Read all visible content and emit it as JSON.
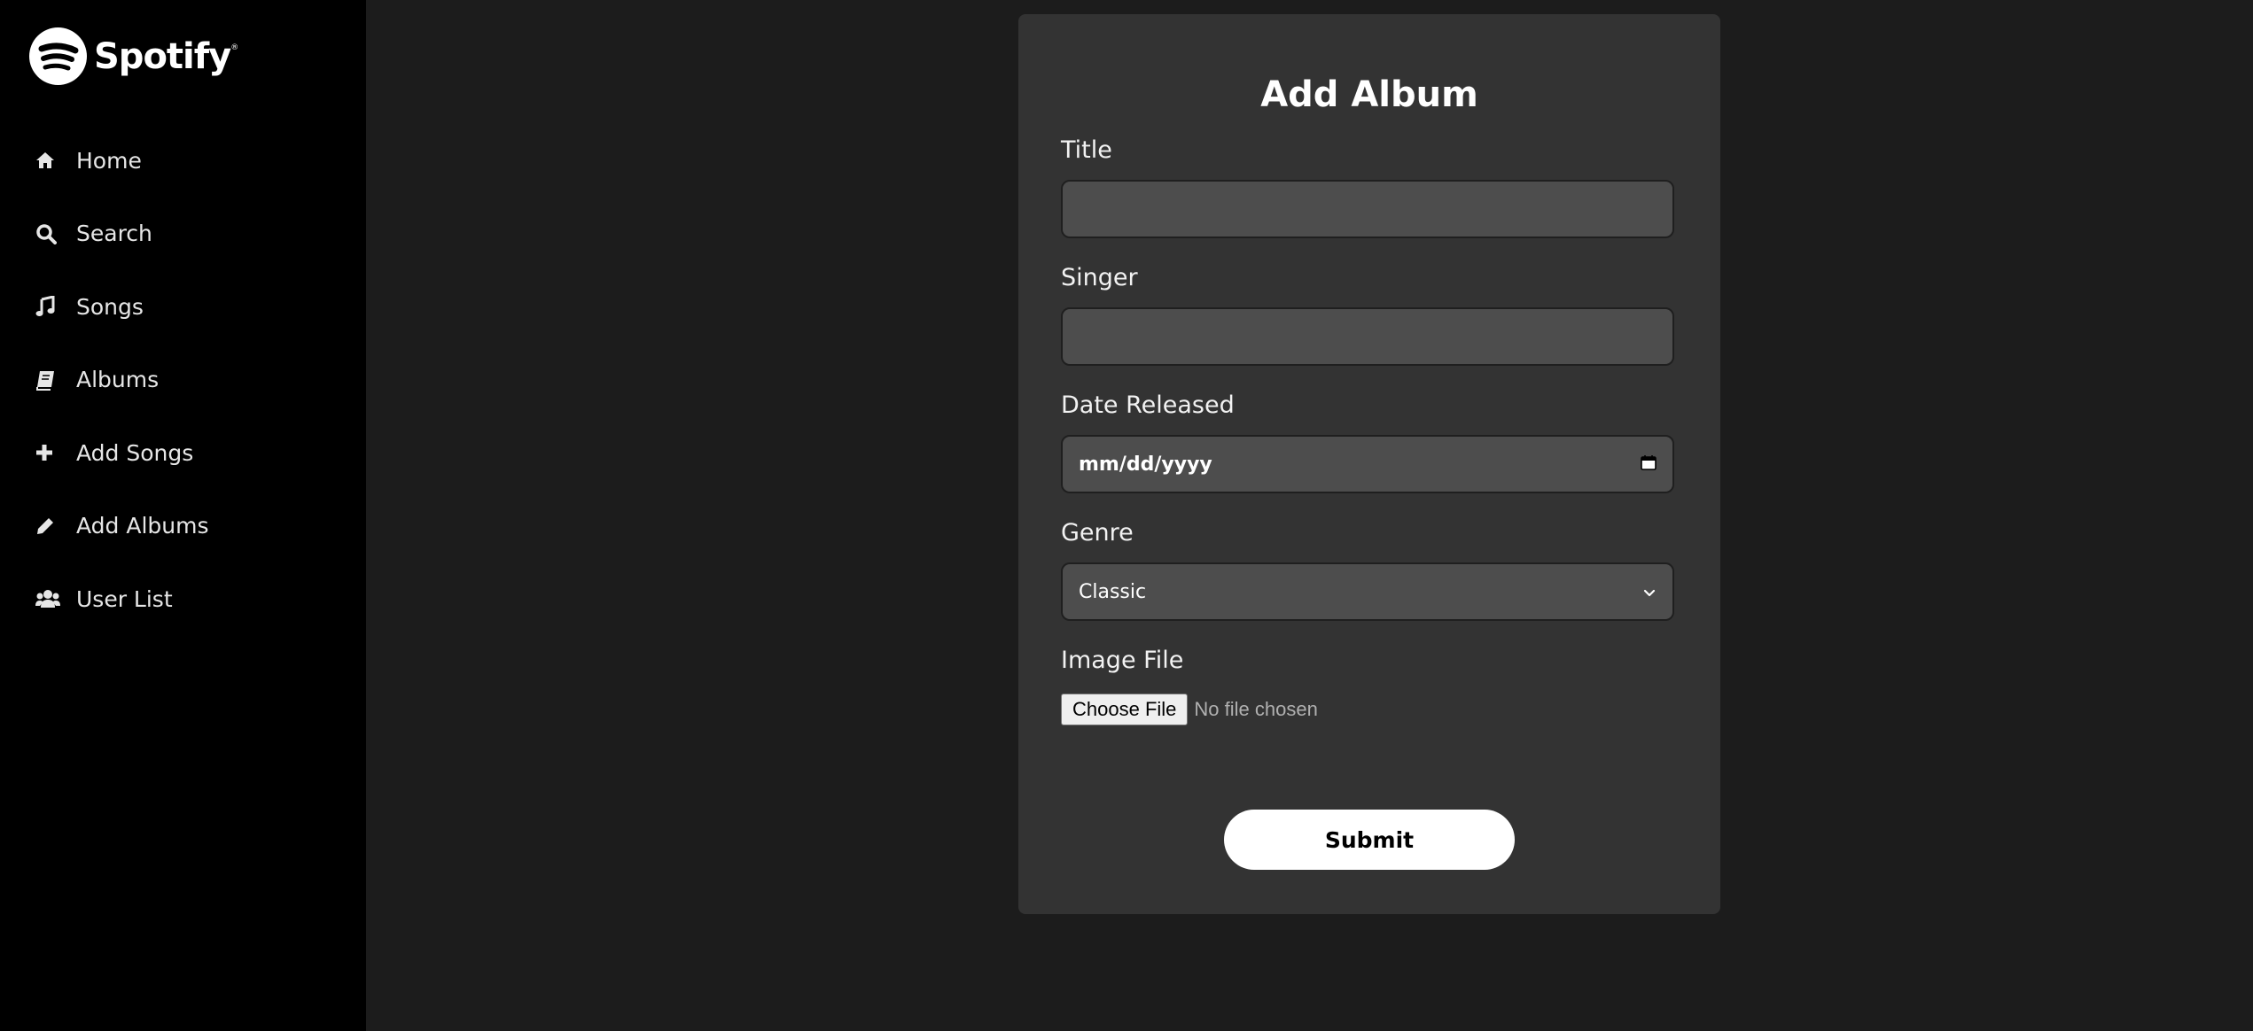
{
  "brand": {
    "name": "Spotify",
    "trademark": "®",
    "logo_icon": "spotify-logo-icon",
    "accent": "#ffffff"
  },
  "sidebar": {
    "items": [
      {
        "label": "Home",
        "icon": "home-icon"
      },
      {
        "label": "Search",
        "icon": "search-icon"
      },
      {
        "label": "Songs",
        "icon": "music-note-icon"
      },
      {
        "label": "Albums",
        "icon": "book-icon"
      },
      {
        "label": "Add Songs",
        "icon": "plus-icon"
      },
      {
        "label": "Add Albums",
        "icon": "pencil-icon"
      },
      {
        "label": "User List",
        "icon": "users-icon"
      }
    ]
  },
  "form": {
    "title": "Add Album",
    "fields": {
      "title": {
        "label": "Title",
        "value": ""
      },
      "singer": {
        "label": "Singer",
        "value": ""
      },
      "date_released": {
        "label": "Date Released",
        "placeholder": "mm/dd/yyyy",
        "icon": "calendar-icon"
      },
      "genre": {
        "label": "Genre",
        "selected": "Classic",
        "icon": "chevron-down-icon"
      },
      "image_file": {
        "label": "Image File",
        "button_label": "Choose File",
        "status": "No file chosen"
      }
    },
    "submit_label": "Submit"
  },
  "colors": {
    "sidebar_bg": "#000000",
    "page_bg": "#1c1c1c",
    "card_bg": "#333333",
    "input_bg": "#4d4d4d"
  }
}
